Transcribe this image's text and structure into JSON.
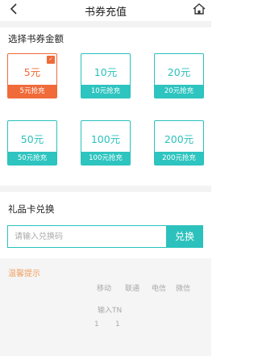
{
  "header": {
    "title": "书券充值",
    "back_icon": "chevron-left-icon",
    "home_icon": "home-icon"
  },
  "amount_section": {
    "title": "选择书券金额",
    "options": [
      {
        "amount": "5元",
        "cta": "5元抢充",
        "selected": true
      },
      {
        "amount": "10元",
        "cta": "10元抢充",
        "selected": false
      },
      {
        "amount": "20元",
        "cta": "20元抢充",
        "selected": false
      },
      {
        "amount": "50元",
        "cta": "50元抢充",
        "selected": false
      },
      {
        "amount": "100元",
        "cta": "100元抢充",
        "selected": false
      },
      {
        "amount": "200元",
        "cta": "200元抢充",
        "selected": false
      }
    ]
  },
  "gift_card": {
    "title": "礼品卡兑换",
    "placeholder": "请输入兑换码",
    "button_label": "兑换"
  },
  "tips": {
    "title": "温馨提示",
    "lines": [
      [
        "移动",
        "联通",
        "电信",
        "微信"
      ],
      [
        "输入TN"
      ],
      [
        "1",
        "1"
      ]
    ]
  },
  "colors": {
    "accent": "#2cc1bc",
    "selected": "#f06a3a",
    "tips_title": "#f0a060"
  }
}
